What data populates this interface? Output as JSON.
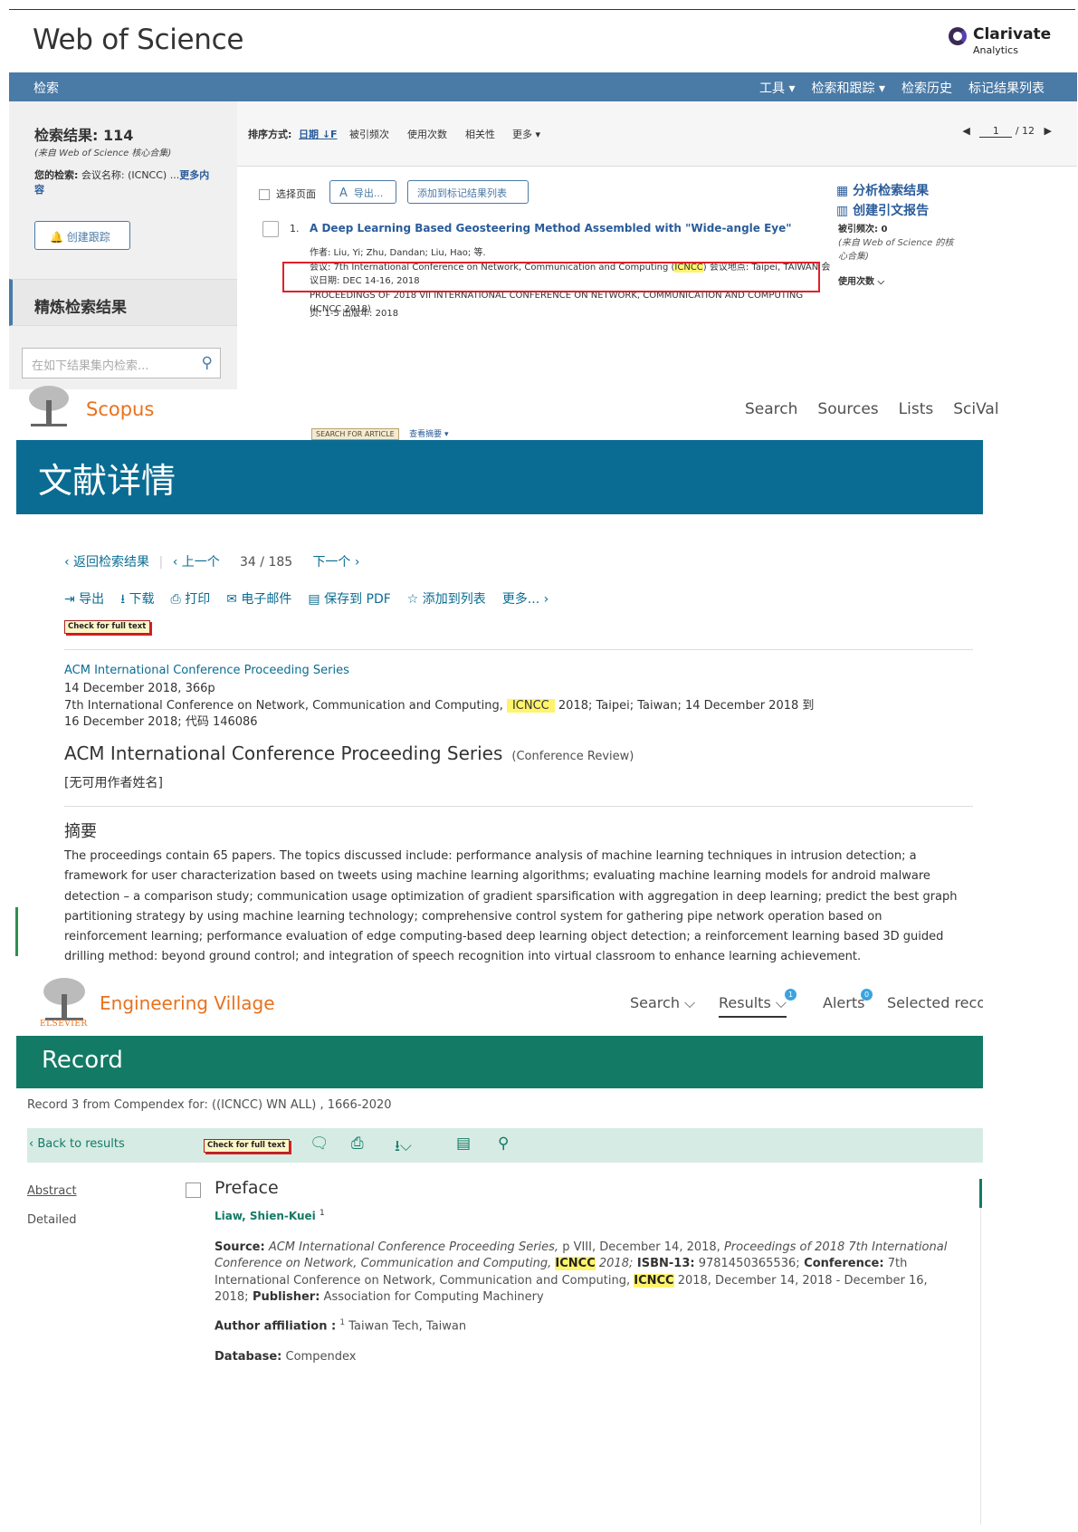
{
  "wos": {
    "brand": "Web of Science",
    "clarivate": {
      "line1": "Clarivate",
      "line2": "Analytics"
    },
    "menu": {
      "search": "检索",
      "items": [
        "工具 ▾",
        "检索和跟踪 ▾",
        "检索历史",
        "标记结果列表"
      ]
    },
    "left": {
      "results_count": "检索结果: 114",
      "results_from": "(来自 Web of Science 核心合集)",
      "query_label": "您的检索:",
      "query_value": " 会议名称: (ICNCC) ...",
      "query_more": "更多内容",
      "create_alert": "创建跟踪",
      "refine": "精炼检索结果",
      "filter_placeholder": "在如下结果集内检索..."
    },
    "sort": {
      "label": "排序方式:",
      "options": [
        "日期 ↓F",
        "被引频次",
        "使用次数",
        "相关性",
        "更多 ▾"
      ]
    },
    "pager": {
      "page": "1",
      "total": "/ 12"
    },
    "tools": {
      "select_page": "选择页面",
      "export": "导出...",
      "add_marked": "添加到标记结果列表",
      "analyze": "分析检索结果",
      "citation_report": "创建引文报告"
    },
    "record": {
      "num": "1.",
      "title": "A Deep Learning Based Geosteering Method Assembled with \"Wide-angle Eye\"",
      "authors": "作者: Liu, Yi; Zhu, Dandan; Liu, Hao; 等.",
      "conf_pre": "会议: 7th International Conference on Network, Communication and Computing (",
      "conf_hl": "ICNCC",
      "conf_post": ") 会议地点: Taipei, TAIWAN 会议日期: DEC 14-16, 2018",
      "proceedings": "PROCEEDINGS OF 2018 VII INTERNATIONAL CONFERENCE ON NETWORK, COMMUNICATION AND COMPUTING (ICNCC 2018)",
      "pages": "页: 1-5   出版年: 2018",
      "times_cited": "被引频次: 0",
      "times_cited_src": "(来自 Web of Science 的核心合集)",
      "usage": "使用次数 ⌵",
      "sfa_tag": "SEARCH FOR ARTICLE",
      "view_abstract": "查看摘要 ▾"
    }
  },
  "scopus": {
    "brand": "Scopus",
    "nav": [
      "Search",
      "Sources",
      "Lists",
      "SciVal"
    ],
    "banner": "文献详情",
    "back": "‹ 返回检索结果",
    "prev": "‹ 上一个",
    "position": "34  /  185",
    "next": "下一个 ›",
    "actions": [
      "⇥ 导出",
      "⭳ 下载",
      "⎙ 打印",
      "✉ 电子邮件",
      "▤ 保存到 PDF",
      "☆ 添加到列表",
      "更多... ›"
    ],
    "check_full_text": "Check for full text",
    "source_link": "ACM International Conference Proceeding Series",
    "date_line": "14 December 2018, 366p",
    "conf_pre": "7th International Conference on Network, Communication and Computing, ",
    "conf_hl": "ICNCC",
    "conf_post": " 2018; Taipei; Taiwan; 14 December 2018 到 16 December 2018; 代码 146086",
    "title": "ACM International Conference Proceeding Series",
    "doc_type": "(Conference Review)",
    "authors": "[无可用作者姓名]",
    "abstract_head": "摘要",
    "abstract": "The proceedings contain 65 papers. The topics discussed include: performance analysis of machine learning techniques in intrusion detection; a framework for user characterization based on tweets using machine learning algorithms; evaluating machine learning models for android malware detection – a comparison study; communication usage optimization of gradient sparsification with aggregation in deep learning; predict the best graph partitioning strategy by using machine learning technology; comprehensive control system for gathering pipe network operation based on reinforcement learning; performance evaluation of edge computing-based deep learning object detection; a reinforcement learning based 3D guided drilling method: beyond ground control; and integration of speech recognition into virtual classroom to enhance learning achievement."
  },
  "ev": {
    "brand": "Engineering Village",
    "elsevier": "ELSEVIER",
    "nav": {
      "search": "Search ⌵",
      "results": "Results ⌵",
      "results_badge": "1",
      "alerts": "Alerts",
      "alerts_badge": "0",
      "selected": "Selected records"
    },
    "banner": "Record",
    "record_info": "Record 3 from Compendex for: ((ICNCC) WN ALL) , 1666-2020",
    "back": "‹ Back to results",
    "check_full_text": "Check for full text",
    "side": {
      "abstract": "Abstract",
      "detailed": "Detailed"
    },
    "title": "Preface",
    "author": "Liaw, Shien-Kuei",
    "author_sup": "1",
    "source_label": "Source:",
    "source_a": " ACM International Conference Proceeding Series,",
    "source_b": " p VIII, December 14, 2018, ",
    "source_c": "Proceedings of 2018 7th International Conference on Network, Communication and Computing, ",
    "hl": "ICNCC",
    "source_d": " 2018;",
    "isbn_label": "  ISBN-13:",
    "isbn": " 9781450365536;",
    "conf_label": " Conference:",
    "conf_a": " 7th International Conference on Network, Communication and Computing, ",
    "conf_b": " 2018, December 14, 2018 - December 16, 2018;",
    "pub_label": " Publisher:",
    "pub": " Association for Computing Machinery",
    "affil_label": "Author affiliation :",
    "affil_sup": "1",
    "affil": " Taiwan Tech, Taiwan",
    "db_label": "Database:",
    "db": " Compendex"
  }
}
